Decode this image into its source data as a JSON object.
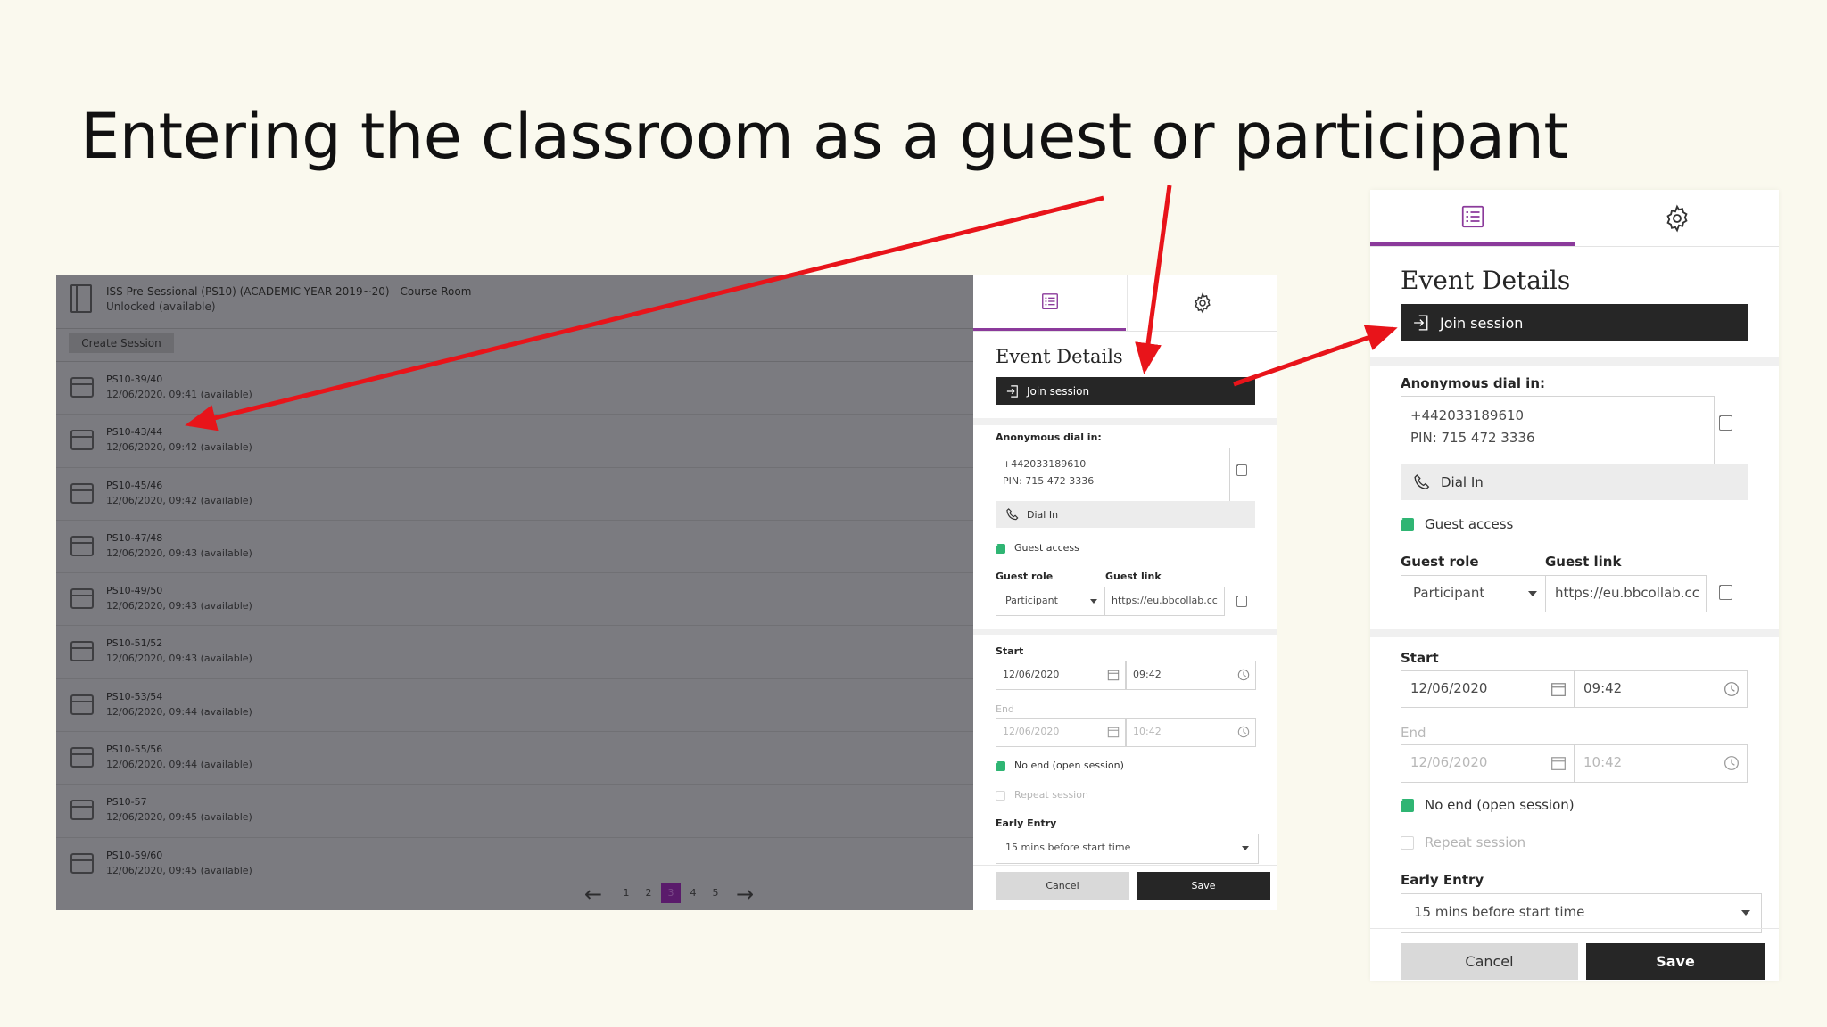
{
  "slide": {
    "title": "Entering the classroom as a guest or participant"
  },
  "course_room": {
    "title": "ISS Pre-Sessional (PS10) (ACADEMIC YEAR 2019~20) - Course Room",
    "status": "Unlocked (available)",
    "create_session_label": "Create Session",
    "sessions": [
      {
        "name": "PS10-39/40",
        "datetime": "12/06/2020, 09:41 (available)"
      },
      {
        "name": "PS10-43/44",
        "datetime": "12/06/2020, 09:42 (available)"
      },
      {
        "name": "PS10-45/46",
        "datetime": "12/06/2020, 09:42 (available)"
      },
      {
        "name": "PS10-47/48",
        "datetime": "12/06/2020, 09:43 (available)"
      },
      {
        "name": "PS10-49/50",
        "datetime": "12/06/2020, 09:43 (available)"
      },
      {
        "name": "PS10-51/52",
        "datetime": "12/06/2020, 09:43 (available)"
      },
      {
        "name": "PS10-53/54",
        "datetime": "12/06/2020, 09:44 (available)"
      },
      {
        "name": "PS10-55/56",
        "datetime": "12/06/2020, 09:44 (available)"
      },
      {
        "name": "PS10-57",
        "datetime": "12/06/2020, 09:45 (available)"
      },
      {
        "name": "PS10-59/60",
        "datetime": "12/06/2020, 09:45 (available)"
      }
    ],
    "pagination": {
      "pages": [
        "1",
        "2",
        "3",
        "4",
        "5"
      ],
      "current": "3"
    }
  },
  "event_details": {
    "heading": "Event Details",
    "join_label": "Join session",
    "dial_in_label": "Anonymous dial in:",
    "dial_in_number": "+442033189610",
    "dial_in_pin": "PIN: 715 472 3336",
    "dial_in_button": "Dial In",
    "guest_access_label": "Guest access",
    "guest_role_label": "Guest role",
    "guest_role_value": "Participant",
    "guest_link_label": "Guest link",
    "guest_link_value": "https://eu.bbcollab.cc",
    "start_label": "Start",
    "start_date": "12/06/2020",
    "start_time": "09:42",
    "end_label": "End",
    "end_date": "12/06/2020",
    "end_time": "10:42",
    "no_end_label": "No end (open session)",
    "repeat_label": "Repeat session",
    "early_entry_label": "Early Entry",
    "early_entry_value": "15 mins before start time",
    "cancel_label": "Cancel",
    "save_label": "Save"
  },
  "colors": {
    "accent": "#8b3a9b",
    "checkbox": "#2fb573",
    "arrow": "#e8141a",
    "dark_button": "#262626"
  },
  "icons": {
    "details_tab": "list-icon",
    "settings_tab": "gear-icon",
    "join": "enter-icon",
    "dial": "phone-icon",
    "copy": "copy-icon",
    "calendar": "calendar-icon",
    "clock": "clock-icon"
  }
}
